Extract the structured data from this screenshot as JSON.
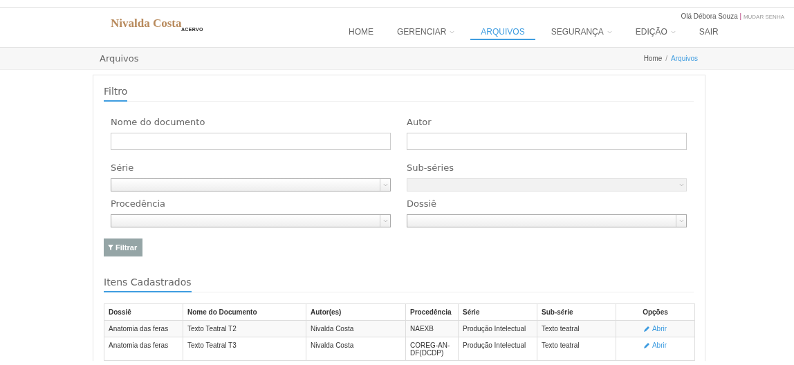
{
  "header": {
    "logo": "Nivalda Costa",
    "logo_sub": "ACERVO",
    "greeting": "Olá Débora Souza",
    "separator": "|",
    "change_password": "MUDAR SENHA",
    "nav": [
      {
        "label": "HOME",
        "selected": false,
        "dropdown": false
      },
      {
        "label": "GERENCIAR",
        "selected": false,
        "dropdown": true
      },
      {
        "label": "ARQUIVOS",
        "selected": true,
        "dropdown": false
      },
      {
        "label": "SEGURANÇA",
        "selected": false,
        "dropdown": true
      },
      {
        "label": "EDIÇÃO",
        "selected": false,
        "dropdown": true
      },
      {
        "label": "SAIR",
        "selected": false,
        "dropdown": false
      }
    ]
  },
  "page_bar": {
    "title": "Arquivos",
    "breadcrumb": [
      {
        "label": "Home",
        "selected": false
      },
      {
        "label": "Arquivos",
        "selected": true
      }
    ],
    "breadcrumb_separator": "/"
  },
  "filter": {
    "title": "Filtro",
    "fields": [
      {
        "label": "Nome do documento",
        "kind": "text",
        "disabled": false
      },
      {
        "label": "Autor",
        "kind": "text",
        "disabled": false
      },
      {
        "label": "Série",
        "kind": "select",
        "disabled": false
      },
      {
        "label": "Sub-séries",
        "kind": "select",
        "disabled": true
      },
      {
        "label": "Procedência",
        "kind": "select",
        "disabled": false
      },
      {
        "label": "Dossiê",
        "kind": "select",
        "disabled": false
      }
    ],
    "button": "Filtrar"
  },
  "items": {
    "title": "Itens Cadastrados",
    "columns": [
      "Dossiê",
      "Nome do Documento",
      "Autor(es)",
      "Procedência",
      "Série",
      "Sub-série",
      "Opções"
    ],
    "rows": [
      {
        "cells": [
          "Anatomia das feras",
          "Texto Teatral T2",
          "Nivalda Costa",
          "NAEXB",
          "Produção Intelectual",
          "Texto teatral"
        ],
        "action": "Abrir"
      },
      {
        "cells": [
          "Anatomia das feras",
          "Texto Teatral T3",
          "Nivalda Costa",
          "COREG-AN-DF(DCDP)",
          "Produção Intelectual",
          "Texto teatral"
        ],
        "action": "Abrir"
      }
    ]
  }
}
